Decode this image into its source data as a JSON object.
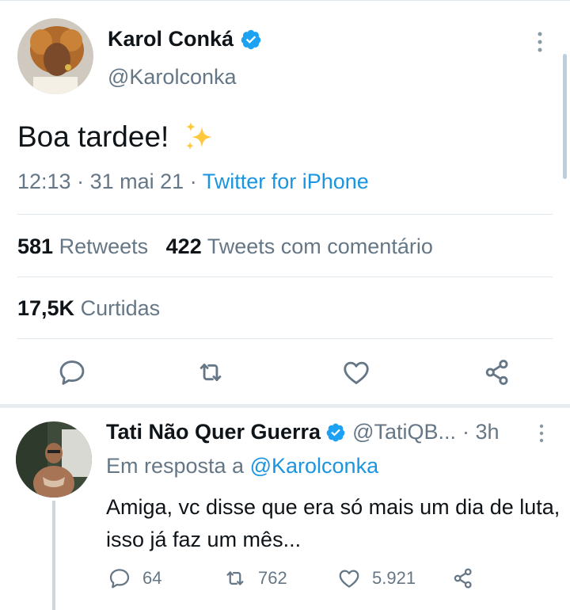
{
  "main_tweet": {
    "author_name": "Karol Conká",
    "author_handle": "@Karolconka",
    "verified": true,
    "text": "Boa tardee!",
    "emoji_icon": "sparkles-icon",
    "time": "12:13",
    "date": "31 mai 21",
    "source": "Twitter for iPhone",
    "retweets_count": "581",
    "retweets_label": "Retweets",
    "quotes_count": "422",
    "quotes_label": "Tweets com comentário",
    "likes_count": "17,5K",
    "likes_label": "Curtidas"
  },
  "reply": {
    "author_name": "Tati Não Quer Guerra",
    "author_handle": "@TatiQB...",
    "verified": true,
    "time": "3h",
    "reply_to_prefix": "Em resposta a",
    "reply_to_handle": "@Karolconka",
    "text": "Amiga, vc disse que era só mais um dia de luta, isso já faz um mês...",
    "replies": "64",
    "retweets": "762",
    "likes": "5.921"
  },
  "colors": {
    "link": "#1b95e0",
    "verified": "#1da1f2",
    "secondary_text": "#657786",
    "divider": "#e1e8ed"
  }
}
